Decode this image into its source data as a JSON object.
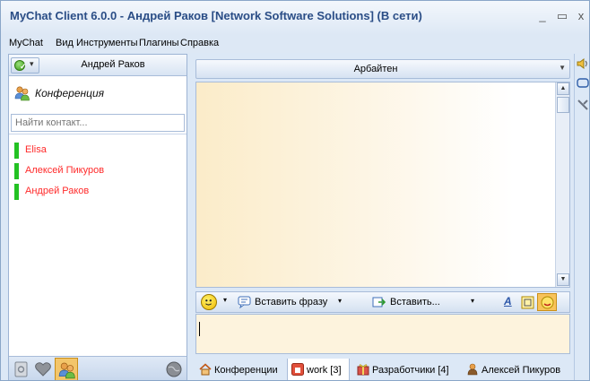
{
  "window": {
    "title": "MyChat Client 6.0.0 - Андрей Раков [Network Software Solutions] (В сети)",
    "minimize_glyph": "_",
    "maximize_glyph": "▭",
    "close_glyph": "x"
  },
  "menu": [
    "MyChat",
    "Вид",
    "Инструменты",
    "Плагины",
    "Справка"
  ],
  "left_pane": {
    "current_user": "Андрей Раков",
    "status_icon": "online-check-icon",
    "conference_label": "Конференция",
    "search_placeholder": "Найти контакт...",
    "contacts": [
      {
        "name": "Elisa",
        "status_color": "#23c223",
        "name_color": "#ff2a2a"
      },
      {
        "name": "Алексей Пикуров",
        "status_color": "#23c223",
        "name_color": "#ff2a2a"
      },
      {
        "name": "Андрей Раков",
        "status_color": "#23c223",
        "name_color": "#ff2a2a"
      }
    ],
    "bottom_icons": [
      "notes-icon",
      "favorites-heart-icon",
      "users-icon",
      "globe-icon"
    ]
  },
  "right_pane": {
    "channel_name": "Арбайтен",
    "toolbar": {
      "insert_phrase": "Вставить фразу",
      "insert": "Вставить..."
    },
    "tabs": [
      {
        "label": "Конференции",
        "icon": "home-icon"
      },
      {
        "label": "work [3]",
        "icon": "conference-icon"
      },
      {
        "label": "Разработчики [4]",
        "icon": "gift-icon"
      },
      {
        "label": "Алексей Пикуров",
        "icon": "user-icon"
      }
    ]
  },
  "colors": {
    "title_text": "#2a4d86",
    "online_green": "#23c223",
    "contact_red": "#ff2a2a",
    "chat_bg": "#fbecc9"
  }
}
